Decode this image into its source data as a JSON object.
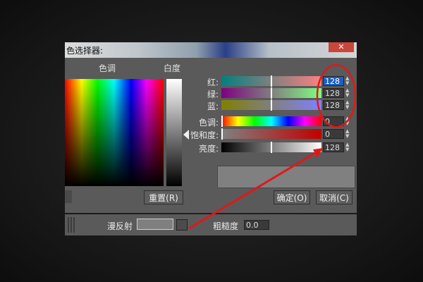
{
  "dialog": {
    "title": "色选择器:",
    "close_glyph": "✕"
  },
  "labels": {
    "hue_header": "色调",
    "whiteness_header": "白度"
  },
  "channels": [
    {
      "label": "红:",
      "value": "128",
      "selected": true
    },
    {
      "label": "绿:",
      "value": "128",
      "selected": false
    },
    {
      "label": "蓝:",
      "value": "128",
      "selected": false
    },
    {
      "label": "色调:",
      "value": "0",
      "selected": false
    },
    {
      "label": "饱和度:",
      "value": "0",
      "selected": false
    },
    {
      "label": "亮度:",
      "value": "128",
      "selected": false
    }
  ],
  "buttons": {
    "reset": "重置(R)",
    "ok": "确定(O)",
    "cancel": "取消(C)"
  },
  "material": {
    "diffuse_label": "漫反射",
    "roughness_label": "粗糙度",
    "roughness_value": "0.0"
  },
  "colors": {
    "preview": "#808080",
    "annotation": "#e01818",
    "selected_field": "#1f5fc0"
  }
}
